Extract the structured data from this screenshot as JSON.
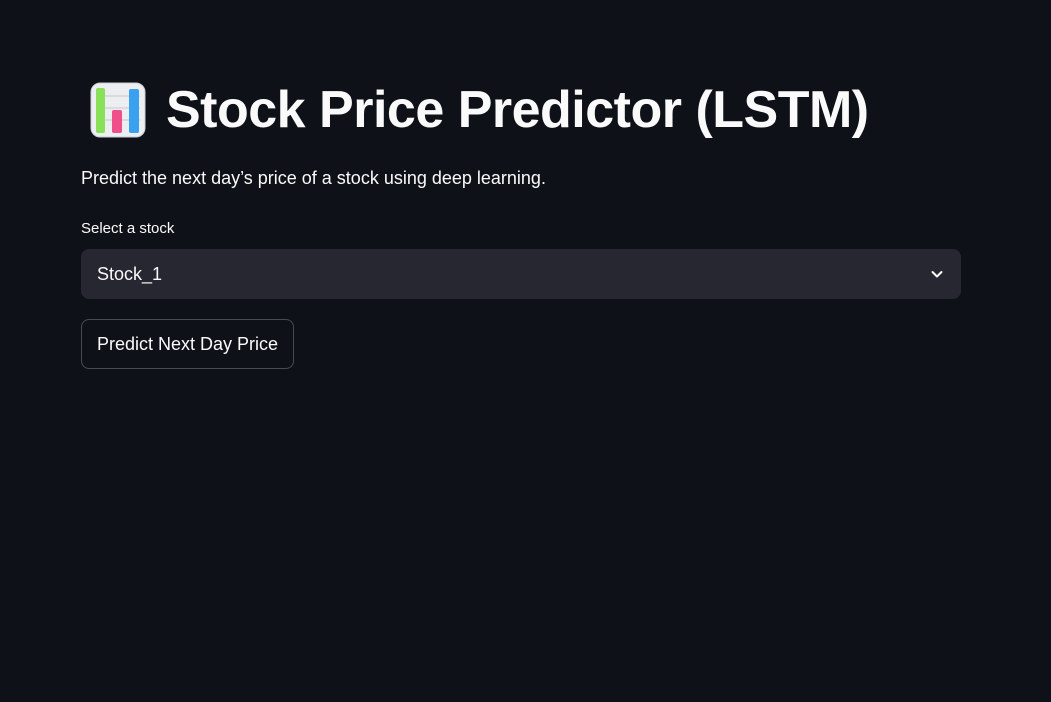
{
  "header": {
    "icon": "bar-chart-emoji-icon",
    "title": "Stock Price Predictor (LSTM)",
    "subtitle": "Predict the next day’s price of a stock using deep learning."
  },
  "stock_select": {
    "label": "Select a stock",
    "selected_value": "Stock_1",
    "icon": "chevron-down-icon"
  },
  "actions": {
    "predict_label": "Predict Next Day Price"
  },
  "colors": {
    "background": "#0e1117",
    "input_background": "#262730",
    "text": "#fafafa",
    "chart_icon_bar_green": "#8be05a",
    "chart_icon_bar_pink": "#f0508a",
    "chart_icon_bar_blue": "#3aa0f0"
  }
}
